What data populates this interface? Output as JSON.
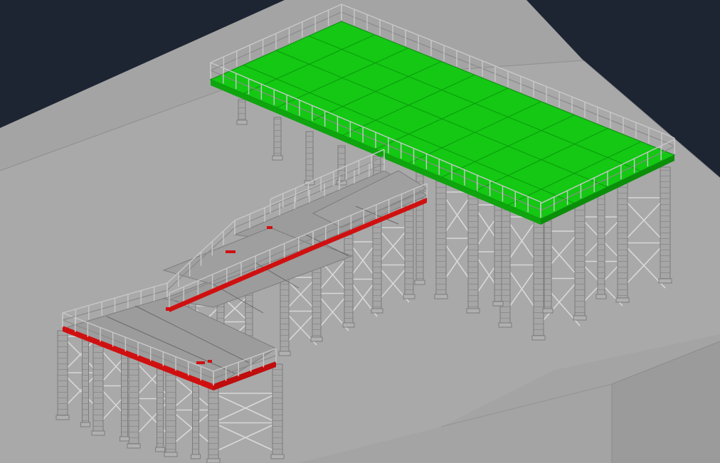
{
  "viewport": {
    "background_color": "#1d2532",
    "ground_color": "#a4a4a4",
    "ground_shade_color": "#999999",
    "deck_color": "#9c9c9c",
    "green_deck_color": "#14c814",
    "green_edge_color": "#0fa50f",
    "red_edge_color": "#d01010",
    "column_color": "#a6a6a6",
    "rail_color": "#c8c8c8"
  },
  "model": {
    "description_visible_text": ""
  }
}
